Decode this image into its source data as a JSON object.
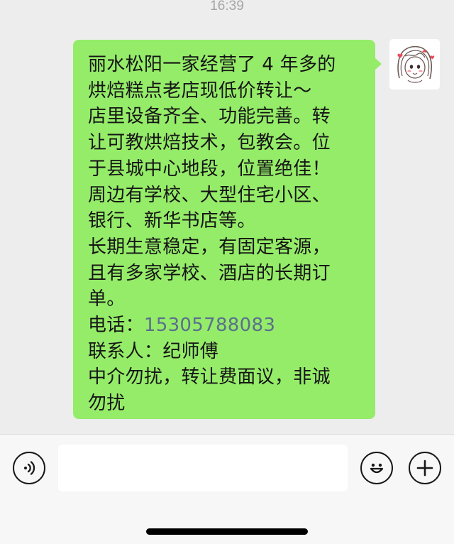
{
  "status": {
    "time": "16:39"
  },
  "message": {
    "lines": [
      "丽水松阳一家经营了 4 年多的",
      "烘焙糕点老店现低价转让～",
      "店里设备齐全、功能完善。转",
      "让可教烘焙技术，包教会。位",
      "于县城中心地段，位置绝佳！",
      "周边有学校、大型住宅小区、",
      "银行、新华书店等。",
      "长期生意稳定，有固定客源，",
      "且有多家学校、酒店的长期订",
      "单。"
    ],
    "phone_label": "电话：",
    "phone_number": "15305788083",
    "contact_line": "联系人：纪师傅",
    "closing_lines": [
      "中介勿扰，转让费面议，非诚",
      "勿扰"
    ]
  },
  "input_bar": {
    "text_value": "",
    "voice_icon": "voice-icon",
    "emoji_icon": "emoji-icon",
    "plus_icon": "plus-icon"
  },
  "colors": {
    "bubble": "#95ec69",
    "background": "#ededed",
    "link": "#5a6f8e"
  }
}
